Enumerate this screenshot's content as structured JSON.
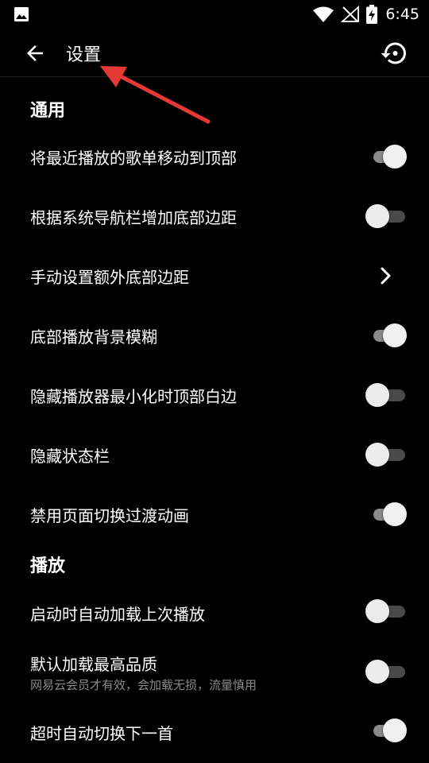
{
  "status_bar": {
    "time": "6:45",
    "icons": [
      "image-icon",
      "wifi-icon",
      "no-signal-icon",
      "battery-charging-icon"
    ]
  },
  "toolbar": {
    "title": "设置",
    "back_icon": "arrow-back-icon",
    "restore_icon": "restore-icon"
  },
  "annotation_color": "#e53935",
  "sections": {
    "general": {
      "header": "通用",
      "items": [
        {
          "label": "将最近播放的歌单移动到顶部",
          "control": "switch",
          "on": true
        },
        {
          "label": "根据系统导航栏增加底部边距",
          "control": "switch",
          "on": false
        },
        {
          "label": "手动设置额外底部边距",
          "control": "chevron"
        },
        {
          "label": "底部播放背景模糊",
          "control": "switch",
          "on": true
        },
        {
          "label": "隐藏播放器最小化时顶部白边",
          "control": "switch",
          "on": false
        },
        {
          "label": "隐藏状态栏",
          "control": "switch",
          "on": false
        },
        {
          "label": "禁用页面切换过渡动画",
          "control": "switch",
          "on": true
        }
      ]
    },
    "playback": {
      "header": "播放",
      "items": [
        {
          "label": "启动时自动加载上次播放",
          "control": "switch",
          "on": false
        },
        {
          "label": "默认加载最高品质",
          "sublabel": "网易云会员才有效，会加载无损，流量慎用",
          "control": "switch",
          "on": false
        },
        {
          "label": "超时自动切换下一首",
          "control": "switch",
          "on": true
        }
      ]
    }
  }
}
